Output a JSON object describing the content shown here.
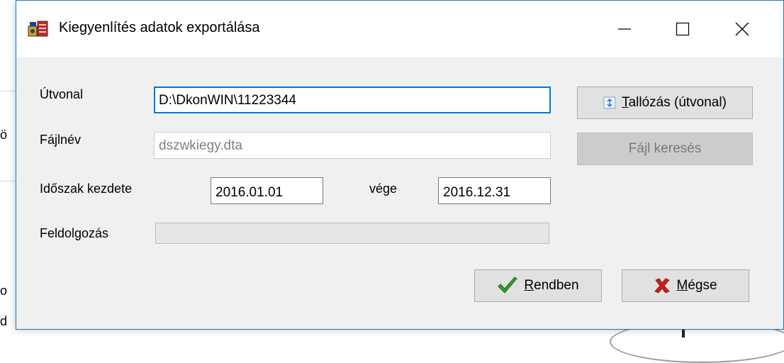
{
  "window": {
    "title": "Kiegyenlítés adatok exportálása"
  },
  "background": {
    "char_1": "ö",
    "char_2": "o",
    "char_3": "d"
  },
  "form": {
    "path_label": "Útvonal",
    "path_value": "D:\\DkonWIN\\11223344",
    "browse_label_u": "T",
    "browse_label_rest": "allózás (útvonal)",
    "filename_label": "Fájlnév",
    "filename_value": "dszwkiegy.dta",
    "find_file_label": "Fájl keresés",
    "period_label": "Időszak  kezdete",
    "period_start": "2016.01.01",
    "end_label": "vége",
    "period_end": "2016.12.31",
    "processing_label": "Feldolgozás",
    "processing_progress": 0
  },
  "buttons": {
    "ok_u": "R",
    "ok_rest": "endben",
    "cancel_u": "M",
    "cancel_rest": "égse"
  },
  "colors": {
    "accent": "#0078d7",
    "ok_check": "#2e9e2e",
    "cancel_x": "#d11a1a"
  },
  "icons": {
    "app": "app-icon",
    "browse": "folder-browse-icon",
    "ok": "checkmark-icon",
    "cancel": "x-icon"
  }
}
